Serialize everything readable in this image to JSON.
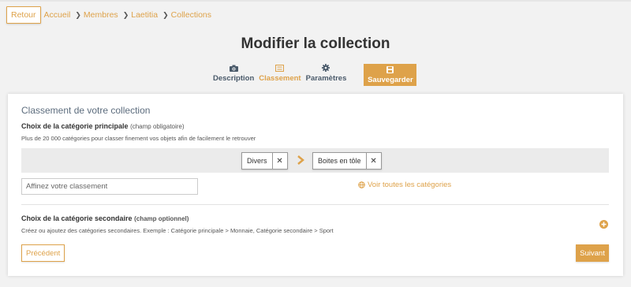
{
  "breadcrumb": {
    "back_label": "Retour",
    "items": [
      "Accueil",
      "Membres",
      "Laetitia",
      "Collections"
    ]
  },
  "page": {
    "title": "Modifier la collection"
  },
  "tabs": [
    {
      "label": "Description",
      "icon": "camera-icon",
      "active": false
    },
    {
      "label": "Classement",
      "icon": "list-icon",
      "active": true
    },
    {
      "label": "Paramètres",
      "icon": "gear-icon",
      "active": false
    }
  ],
  "save": {
    "label": "Sauvegarder",
    "icon": "floppy-icon"
  },
  "classement": {
    "title": "Classement de votre collection",
    "main_label": "Choix de la catégorie principale",
    "main_hint": "(champ obligatoire)",
    "main_desc": "Plus de 20 000 catégories pour classer finement vos objets afin de facilement le retrouver",
    "selected": [
      {
        "label": "Divers",
        "remove": "✕"
      },
      {
        "label": "Boites en tôle",
        "remove": "✕"
      }
    ],
    "refine_placeholder": "Affinez votre classement",
    "see_all": "Voir toutes les catégories",
    "secondary_label": "Choix de la catégorie secondaire",
    "secondary_hint": "(champ optionnel)",
    "secondary_desc": "Créez ou ajoutez des catégories secondaires. Exemple : Catégorie principale > Monnaie, Catégorie secondaire > Sport"
  },
  "nav": {
    "prev": "Précédent",
    "next": "Suivant"
  },
  "colors": {
    "accent": "#dea24a",
    "text": "#333333",
    "muted": "#5d6d7e"
  }
}
